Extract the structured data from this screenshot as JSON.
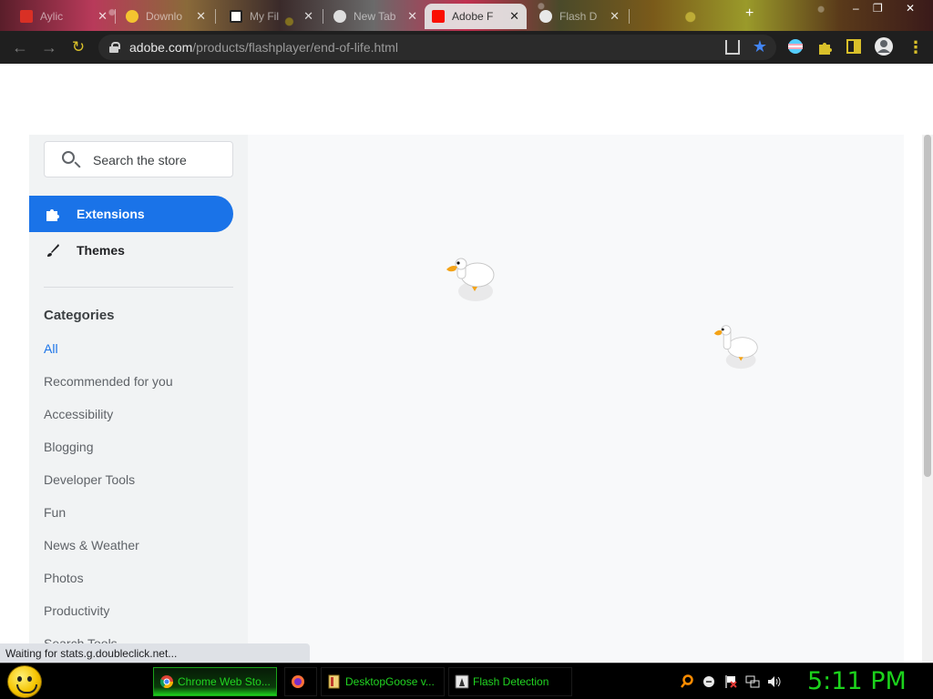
{
  "browser": {
    "tabs": [
      {
        "title": "Aylic",
        "active": false,
        "icon_color": "#d93025"
      },
      {
        "title": "Downlo",
        "active": false,
        "icon_color": "#f4c430"
      },
      {
        "title": "My Fil",
        "active": false,
        "icon_color": "#ffffff"
      },
      {
        "title": "New Tab",
        "active": false,
        "icon_color": "#dddddd"
      },
      {
        "title": "Adobe F",
        "active": true,
        "icon_color": "#fa0f00"
      },
      {
        "title": "Flash D",
        "active": false,
        "icon_color": "#e8e8e8"
      }
    ],
    "tab_close": "✕",
    "new_tab": "+",
    "window_controls": {
      "minimize": "–",
      "maximize": "❐",
      "close": "✕"
    },
    "url": {
      "host": "adobe.com",
      "path": "/products/flashplayer/end-of-life.html"
    },
    "accent_star_color": "#4285f4"
  },
  "store": {
    "search": {
      "placeholder": "Search the store"
    },
    "nav": [
      {
        "label": "Extensions",
        "icon": "puzzle-icon",
        "active": true
      },
      {
        "label": "Themes",
        "icon": "brush-icon",
        "active": false
      }
    ],
    "categories_heading": "Categories",
    "categories": [
      "All",
      "Recommended for you",
      "Accessibility",
      "Blogging",
      "Developer Tools",
      "Fun",
      "News & Weather",
      "Photos",
      "Productivity",
      "Search Tools"
    ],
    "selected_category": "All",
    "accent_color": "#1a73e8"
  },
  "status_bubble": "Waiting for stats.g.doubleclick.net...",
  "taskbar": {
    "buttons": [
      {
        "label": "Chrome Web Sto...",
        "active": true,
        "icon": "chrome-icon"
      },
      {
        "label": "",
        "active": false,
        "icon": "firefox-icon"
      },
      {
        "label": "DesktopGoose v...",
        "active": false,
        "icon": "folder-icon"
      },
      {
        "label": "Flash Detection",
        "active": false,
        "icon": "flash-detection-icon"
      }
    ],
    "clock": "5:11 PM",
    "text_color": "#21d421"
  },
  "overlays": {
    "geese_count": 2
  }
}
